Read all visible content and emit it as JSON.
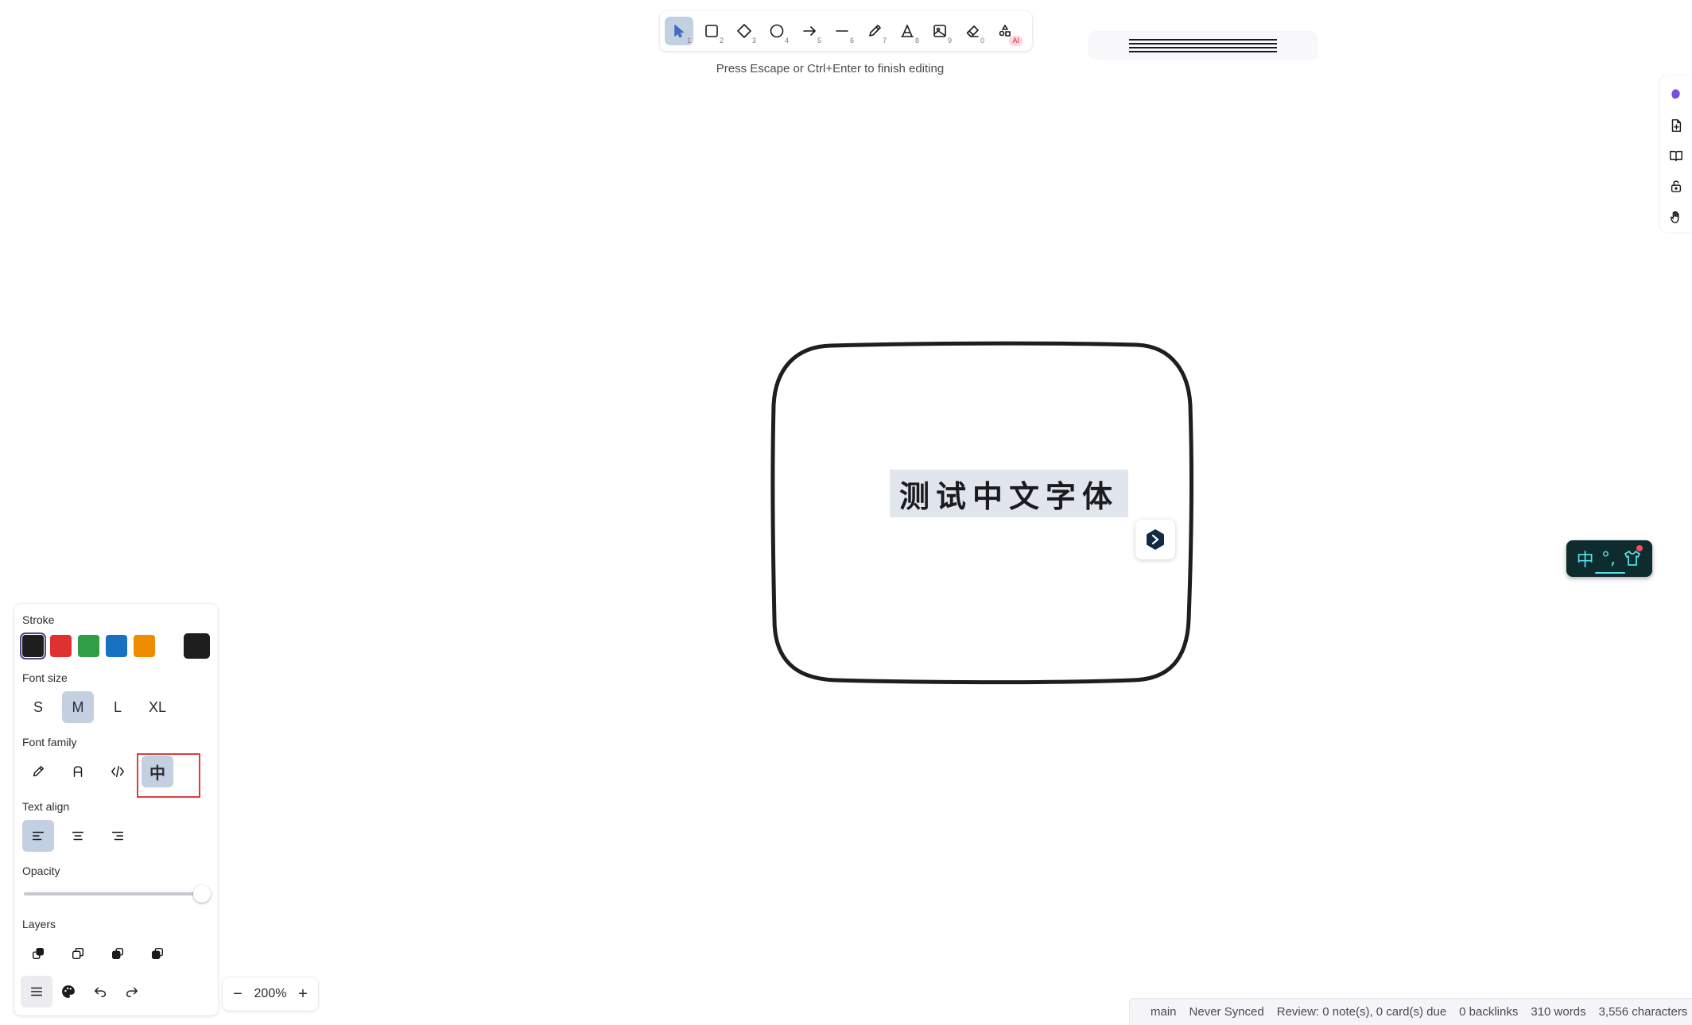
{
  "toolbar": {
    "tools": [
      {
        "name": "selection",
        "shortcut": "1",
        "active": true
      },
      {
        "name": "rectangle",
        "shortcut": "2"
      },
      {
        "name": "diamond",
        "shortcut": "3"
      },
      {
        "name": "ellipse",
        "shortcut": "4"
      },
      {
        "name": "arrow",
        "shortcut": "5"
      },
      {
        "name": "line",
        "shortcut": "6"
      },
      {
        "name": "draw",
        "shortcut": "7"
      },
      {
        "name": "text",
        "shortcut": "8"
      },
      {
        "name": "image",
        "shortcut": "9"
      },
      {
        "name": "eraser",
        "shortcut": "0"
      },
      {
        "name": "more-tools",
        "badge": "AI"
      }
    ],
    "hint": "Press Escape or Ctrl+Enter to finish editing"
  },
  "canvas": {
    "selected_text": "测试中文字体"
  },
  "ime": {
    "mode_char": "中",
    "punct": "°,",
    "shirt": "👕"
  },
  "style_panel": {
    "stroke_label": "Stroke",
    "stroke_colors": [
      "#1e1e1e",
      "#e03131",
      "#2f9e44",
      "#1971c2",
      "#f08c00"
    ],
    "current_color": "#1e1e1e",
    "font_size_label": "Font size",
    "font_sizes": [
      "S",
      "M",
      "L",
      "XL"
    ],
    "font_size_selected": "M",
    "font_family_label": "Font family",
    "font_family_chinese_glyph": "中",
    "text_align_label": "Text align",
    "opacity_label": "Opacity",
    "opacity_value": 100,
    "layers_label": "Layers"
  },
  "zoom": {
    "minus": "−",
    "value": "200%",
    "plus": "+"
  },
  "status_bar": {
    "branch": "main",
    "sync": "Never Synced",
    "review": "Review: 0 note(s), 0 card(s) due",
    "backlinks": "0 backlinks",
    "words": "310 words",
    "characters": "3,556 characters"
  }
}
